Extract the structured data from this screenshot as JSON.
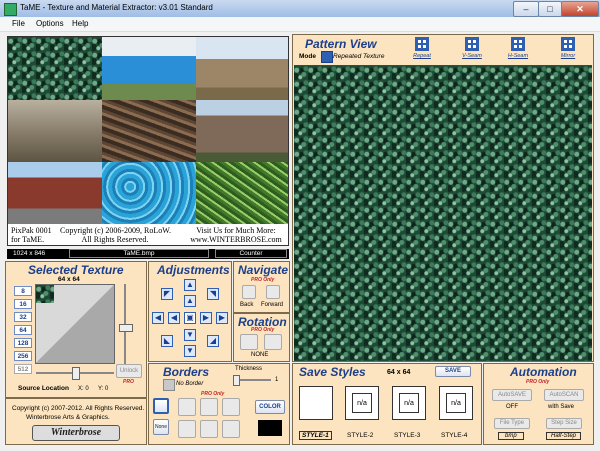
{
  "window": {
    "title": "TaME - Texture and Material Extractor: v3.01 Standard",
    "min": "–",
    "max": "□",
    "close": "✕"
  },
  "menu": [
    "File",
    "Options",
    "Help"
  ],
  "thumbnail_caption": {
    "left": "PixPak 0001\nfor TaME.",
    "mid": "Copyright (c) 2006-2009, RoLoW.\nAll Rights Reserved.",
    "right": "Visit Us for Much More:\nwww.WINTERBROSE.com"
  },
  "status": {
    "dims": "1024 x 846",
    "file": "TaME.bmp",
    "counter": "Counter"
  },
  "pattern_view": {
    "title": "Pattern View",
    "mode_label": "Mode",
    "mode_value": "Repeated Texture",
    "buttons": [
      "Repeat",
      "V-Seam",
      "H-Seam",
      "Mirror"
    ]
  },
  "selected_texture": {
    "title": "Selected Texture",
    "size": "64 x 64",
    "sizes": [
      "8",
      "16",
      "32",
      "64",
      "128",
      "256",
      "512"
    ],
    "unlock": "Unlock",
    "pro": "PRO",
    "source_location": "Source Location",
    "x": "X: 0",
    "y": "Y: 0"
  },
  "adjustments": {
    "title": "Adjustments"
  },
  "navigate": {
    "title": "Navigate",
    "pro": "PRO Only",
    "back": "Back",
    "forward": "Forward"
  },
  "rotation": {
    "title": "Rotation",
    "pro": "PRO Only",
    "value": "NONE"
  },
  "borders": {
    "title": "Borders",
    "pro": "PRO Only",
    "no_border": "No Border",
    "thickness_label": "Thickness",
    "thickness_value": "1",
    "none_btn": "None",
    "color_btn": "COLOR"
  },
  "save_styles": {
    "title": "Save Styles",
    "size": "64 x 64",
    "save": "SAVE",
    "na": "n/a",
    "styles": [
      "STYLE-1",
      "STYLE-2",
      "STYLE-3",
      "STYLE-4"
    ]
  },
  "automation": {
    "title": "Automation",
    "pro": "PRO Only",
    "autosave": "AutoSAVE",
    "autosave_state": "OFF",
    "autoscan": "AutoSCAN",
    "autoscan_state": "with Save",
    "file_type": "File Type",
    "file_type_value": "bmp",
    "step_size": "Step Size",
    "step_size_value": "Half-Step"
  },
  "copyright": {
    "line1": "Copyright (c) 2007-2012. All Rights Reserved.",
    "line2": "Winterbrose Arts & Graphics.",
    "logo": "Winterbrose"
  },
  "colors": {
    "accent": "#1c3f8c",
    "panel": "#fbe4bf",
    "pro": "#c0262b",
    "foliage": "#1d4a34"
  }
}
